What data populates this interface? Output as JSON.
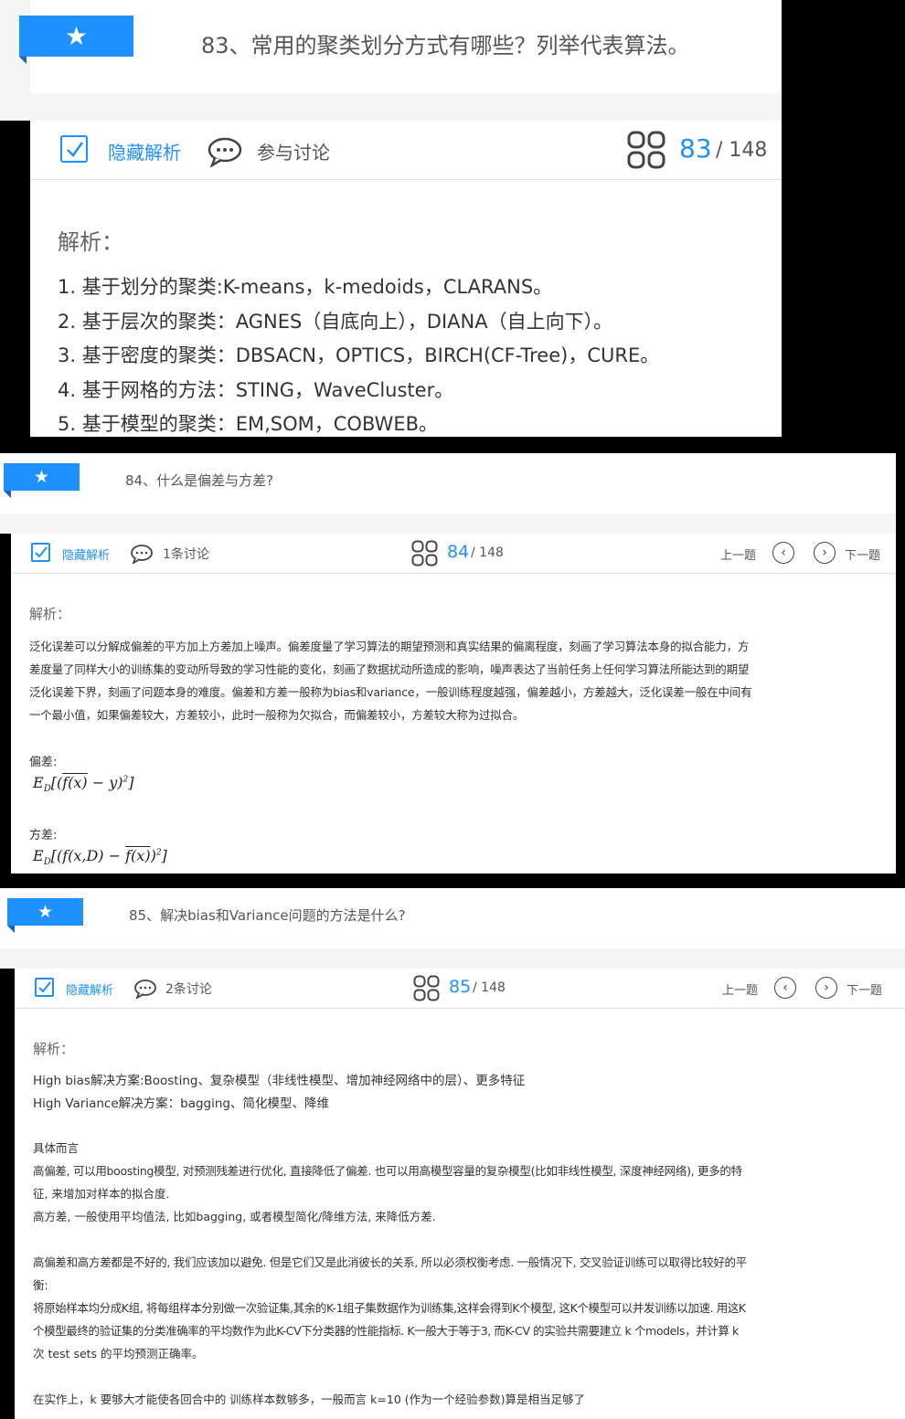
{
  "q83": {
    "title": "83、常用的聚类划分方式有哪些？列举代表算法。",
    "hide_label": "隐藏解析",
    "discuss_label": "参与讨论",
    "current": "83",
    "total": "/ 148",
    "analysis_label": "解析：",
    "items": [
      "1. 基于划分的聚类:K-means，k-medoids，CLARANS。",
      "2. 基于层次的聚类：AGNES（自底向上），DIANA（自上向下）。",
      "3. 基于密度的聚类：DBSACN，OPTICS，BIRCH(CF-Tree)，CURE。",
      "4. 基于网格的方法：STING，WaveCluster。",
      "5. 基于模型的聚类：EM,SOM，COBWEB。"
    ]
  },
  "q84": {
    "title": "84、什么是偏差与方差?",
    "hide_label": "隐藏解析",
    "discuss_label": "1条讨论",
    "current": "84",
    "total": "/ 148",
    "prev_label": "上一题",
    "next_label": "下一题",
    "analysis_label": "解析：",
    "lines": [
      "泛化误差可以分解成偏差的平方加上方差加上噪声。偏差度量了学习算法的期望预测和真实结果的偏离程度，刻画了学习算法本身的拟合能力，方",
      "差度量了同样大小的训练集的变动所导致的学习性能的变化，刻画了数据扰动所造成的影响，噪声表达了当前任务上任何学习算法所能达到的期望",
      "泛化误差下界，刻画了问题本身的难度。偏差和方差一般称为bias和variance，一般训练程度越强，偏差越小，方差越大，泛化误差一般在中间有",
      "一个最小值，如果偏差较大，方差较小，此时一般称为欠拟合，而偏差较小，方差较大称为过拟合。"
    ],
    "bias_label": "偏差:",
    "variance_label": "方差:"
  },
  "q85": {
    "title": "85、解决bias和Variance问题的方法是什么?",
    "hide_label": "隐藏解析",
    "discuss_label": "2条讨论",
    "current": "85",
    "total": "/ 148",
    "prev_label": "上一题",
    "next_label": "下一题",
    "analysis_label": "解析：",
    "p1": [
      "High bias解决方案:Boosting、复杂模型（非线性模型、增加神经网络中的层）、更多特征",
      "High Variance解决方案：bagging、简化模型、降维"
    ],
    "p2": [
      "具体而言",
      "高偏差, 可以用boosting模型, 对预测残差进行优化, 直接降低了偏差. 也可以用高模型容量的复杂模型(比如非线性模型, 深度神经网络), 更多的特",
      "征, 来增加对样本的拟合度.",
      "高方差, 一般使用平均值法, 比如bagging, 或者模型简化/降维方法, 来降低方差."
    ],
    "p3": [
      "高偏差和高方差都是不好的, 我们应该加以避免. 但是它们又是此消彼长的关系, 所以必须权衡考虑. 一般情况下, 交叉验证训练可以取得比较好的平",
      "衡:",
      "将原始样本均分成K组, 将每组样本分别做一次验证集,其余的K-1组子集数据作为训练集,这样会得到K个模型, 这K个模型可以并发训练以加速. 用这K",
      "个模型最终的验证集的分类准确率的平均数作为此K-CV下分类器的性能指标. K一般大于等于3, 而K-CV 的实验共需要建立 k 个models，并计算 k",
      "次 test sets 的平均预测正确率。"
    ],
    "p4": "在实作上，k 要够大才能使各回合中的 训练样本数够多，一般而言 k=10 (作为一个经验参数)算是相当足够了"
  },
  "colors": {
    "accent": "#1e90ff"
  }
}
